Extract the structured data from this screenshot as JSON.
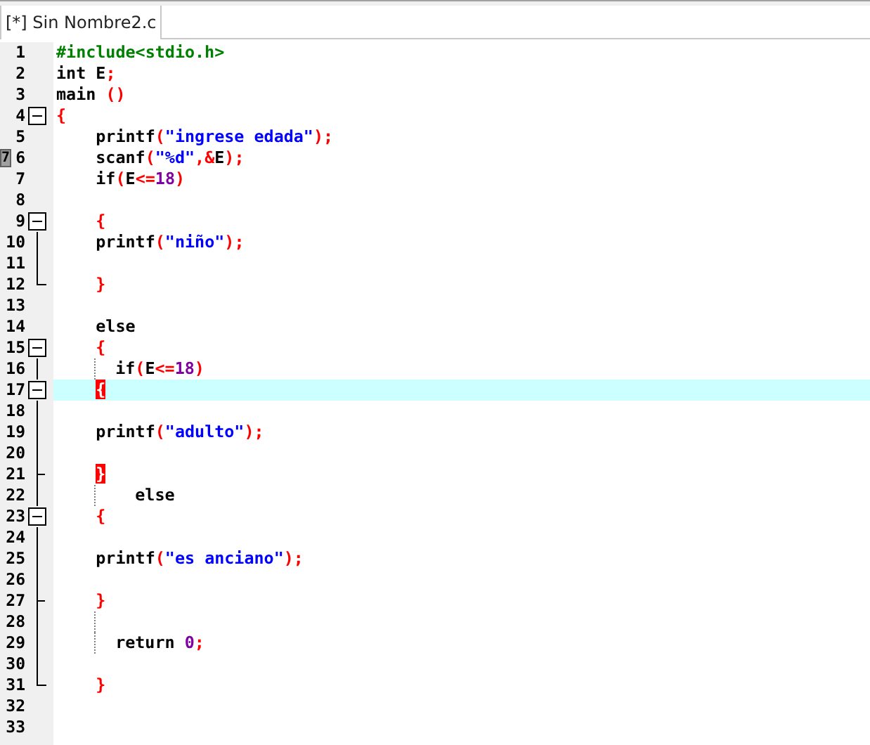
{
  "tab": {
    "label": "[*] Sin Nombre2.c",
    "selected": true
  },
  "lines": [
    {
      "number": "1",
      "tokens": [
        {
          "kind": "preproc",
          "text": "#include<stdio.h>"
        }
      ]
    },
    {
      "number": "2",
      "tokens": [
        {
          "kind": "plain",
          "text": "int E"
        },
        {
          "kind": "symbol",
          "text": ";"
        }
      ]
    },
    {
      "number": "3",
      "tokens": [
        {
          "kind": "plain",
          "text": "main "
        },
        {
          "kind": "symbol",
          "text": "()"
        }
      ]
    },
    {
      "number": "4",
      "fold": {
        "kind": "box"
      },
      "tokens": [
        {
          "kind": "symbol",
          "text": "{"
        }
      ]
    },
    {
      "number": "5",
      "tokens": [
        {
          "kind": "plain",
          "text": "    printf"
        },
        {
          "kind": "symbol",
          "text": "("
        },
        {
          "kind": "string",
          "text": "\"ingrese edada\""
        },
        {
          "kind": "symbol",
          "text": ");"
        }
      ]
    },
    {
      "number": "6",
      "bookmark": "7",
      "tokens": [
        {
          "kind": "plain",
          "text": "    scanf"
        },
        {
          "kind": "symbol",
          "text": "("
        },
        {
          "kind": "string",
          "text": "\"%d\""
        },
        {
          "kind": "symbol",
          "text": ",&"
        },
        {
          "kind": "plain",
          "text": "E"
        },
        {
          "kind": "symbol",
          "text": ");"
        }
      ]
    },
    {
      "number": "7",
      "tokens": [
        {
          "kind": "plain",
          "text": "    if"
        },
        {
          "kind": "symbol",
          "text": "("
        },
        {
          "kind": "plain",
          "text": "E"
        },
        {
          "kind": "symbol",
          "text": "<="
        },
        {
          "kind": "number",
          "text": "18"
        },
        {
          "kind": "symbol",
          "text": ")"
        }
      ]
    },
    {
      "number": "8"
    },
    {
      "number": "9",
      "fold": {
        "kind": "box_start"
      },
      "tokens": [
        {
          "kind": "symbol",
          "text": "    {"
        }
      ]
    },
    {
      "number": "10",
      "fold": {
        "kind": "line"
      },
      "tokens": [
        {
          "kind": "plain",
          "text": "    printf"
        },
        {
          "kind": "symbol",
          "text": "("
        },
        {
          "kind": "string",
          "text": "\"niño\""
        },
        {
          "kind": "symbol",
          "text": ");"
        }
      ]
    },
    {
      "number": "11",
      "fold": {
        "kind": "line"
      }
    },
    {
      "number": "12",
      "fold": {
        "kind": "end"
      },
      "tokens": [
        {
          "kind": "symbol",
          "text": "    }"
        }
      ]
    },
    {
      "number": "13"
    },
    {
      "number": "14",
      "tokens": [
        {
          "kind": "plain",
          "text": "    else"
        }
      ]
    },
    {
      "number": "15",
      "fold": {
        "kind": "box_start"
      },
      "tokens": [
        {
          "kind": "symbol",
          "text": "    {"
        }
      ]
    },
    {
      "number": "16",
      "fold": {
        "kind": "line"
      },
      "guide": true,
      "tokens": [
        {
          "kind": "plain",
          "text": "  if"
        },
        {
          "kind": "symbol",
          "text": "("
        },
        {
          "kind": "plain",
          "text": "E"
        },
        {
          "kind": "symbol",
          "text": "<="
        },
        {
          "kind": "number",
          "text": "18"
        },
        {
          "kind": "symbol",
          "text": ")"
        }
      ]
    },
    {
      "number": "17",
      "fold": {
        "kind": "box_inner"
      },
      "highlighted": true,
      "tokens": [
        {
          "kind": "symbol",
          "text": "    {",
          "match": true
        }
      ]
    },
    {
      "number": "18",
      "fold": {
        "kind": "line"
      }
    },
    {
      "number": "19",
      "fold": {
        "kind": "line"
      },
      "tokens": [
        {
          "kind": "plain",
          "text": "    printf"
        },
        {
          "kind": "symbol",
          "text": "("
        },
        {
          "kind": "string",
          "text": "\"adulto\""
        },
        {
          "kind": "symbol",
          "text": ");"
        }
      ]
    },
    {
      "number": "20",
      "fold": {
        "kind": "line"
      }
    },
    {
      "number": "21",
      "fold": {
        "kind": "tick"
      },
      "tokens": [
        {
          "kind": "symbol",
          "text": "    }",
          "match": true
        }
      ]
    },
    {
      "number": "22",
      "fold": {
        "kind": "line"
      },
      "guide": true,
      "tokens": [
        {
          "kind": "plain",
          "text": "    else"
        }
      ]
    },
    {
      "number": "23",
      "fold": {
        "kind": "box_inner"
      },
      "tokens": [
        {
          "kind": "symbol",
          "text": "    {"
        }
      ]
    },
    {
      "number": "24",
      "fold": {
        "kind": "line"
      }
    },
    {
      "number": "25",
      "fold": {
        "kind": "line"
      },
      "tokens": [
        {
          "kind": "plain",
          "text": "    printf"
        },
        {
          "kind": "symbol",
          "text": "("
        },
        {
          "kind": "string",
          "text": "\"es anciano\""
        },
        {
          "kind": "symbol",
          "text": ");"
        }
      ]
    },
    {
      "number": "26",
      "fold": {
        "kind": "line"
      }
    },
    {
      "number": "27",
      "fold": {
        "kind": "tick"
      },
      "tokens": [
        {
          "kind": "symbol",
          "text": "    }"
        }
      ]
    },
    {
      "number": "28",
      "fold": {
        "kind": "line"
      },
      "guide": true
    },
    {
      "number": "29",
      "fold": {
        "kind": "line"
      },
      "guide": true,
      "tokens": [
        {
          "kind": "plain",
          "text": "  return "
        },
        {
          "kind": "number",
          "text": "0"
        },
        {
          "kind": "symbol",
          "text": ";"
        }
      ]
    },
    {
      "number": "30",
      "fold": {
        "kind": "line"
      }
    },
    {
      "number": "31",
      "fold": {
        "kind": "end"
      },
      "tokens": [
        {
          "kind": "symbol",
          "text": "    }"
        }
      ]
    },
    {
      "number": "32"
    },
    {
      "number": "33"
    }
  ]
}
